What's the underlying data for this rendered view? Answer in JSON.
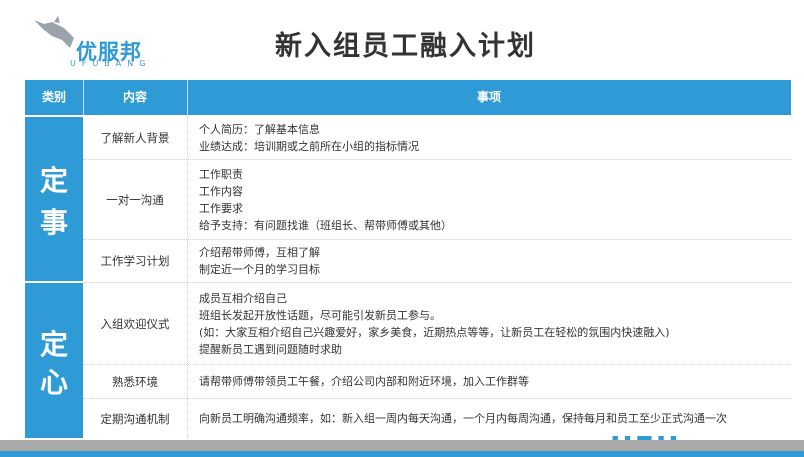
{
  "header": {
    "logo_text": "优服邦",
    "logo_sub": "UFUBANG",
    "title": "新入组员工融入计划"
  },
  "table": {
    "columns": [
      "类别",
      "内容",
      "事项"
    ],
    "categories": [
      {
        "chars": [
          "定",
          "事"
        ]
      },
      {
        "chars": [
          "定",
          "心"
        ]
      }
    ],
    "rows": [
      {
        "content": "了解新人背景",
        "items": [
          "个人简历：了解基本信息",
          "业绩达成：培训期或之前所在小组的指标情况"
        ]
      },
      {
        "content": "一对一沟通",
        "items": [
          "工作职责",
          "工作内容",
          "工作要求",
          "给予支持：有问题找谁（班组长、帮带师傅或其他）"
        ]
      },
      {
        "content": "工作学习计划",
        "items": [
          "介绍帮带师傅，互相了解",
          "制定近一个月的学习目标"
        ]
      },
      {
        "content": "入组欢迎仪式",
        "items": [
          "成员互相介绍自己",
          "班组长发起开放性话题，尽可能引发新员工参与。",
          "(如：大家互相介绍自己兴趣爱好，家乡美食，近期热点等等，让新员工在轻松的氛围内快速融入)",
          "提醒新员工遇到问题随时求助"
        ]
      },
      {
        "content": "熟悉环境",
        "items": [
          "请帮带师傅带领员工午餐，介绍公司内部和附近环境，加入工作群等"
        ]
      },
      {
        "content": "定期沟通机制",
        "items": [
          "向新员工明确沟通频率，如：新入组一周内每天沟通，一个月内每周沟通，保持每月和员工至少正式沟通一次"
        ]
      }
    ]
  },
  "footer": {
    "watermark": "UFU"
  },
  "colors": {
    "accent": "#2f9bd6",
    "footer_gray": "#a9a9a9"
  }
}
